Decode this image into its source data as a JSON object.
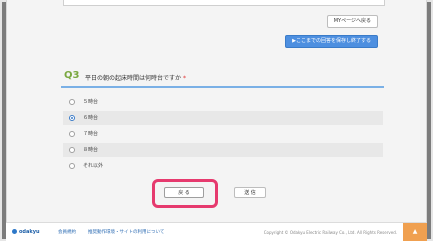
{
  "header": {
    "mypage_label": "MYページへ戻る",
    "save_label": "▶ここまでの回答を保存し終了する"
  },
  "question": {
    "number": "Q3",
    "text": "平日の朝の起床時間は何時台ですか",
    "required_mark": "*",
    "options": [
      {
        "label": "５時台",
        "selected": false
      },
      {
        "label": "６時台",
        "selected": true
      },
      {
        "label": "７時台",
        "selected": false
      },
      {
        "label": "８時台",
        "selected": false
      },
      {
        "label": "それ以外",
        "selected": false
      }
    ]
  },
  "actions": {
    "back_label": "戻 る",
    "send_label": "送 信"
  },
  "footer": {
    "logo_text": "odakyu",
    "link_members": "会員規約",
    "link_env": "推奨動作環境・サイトの利用について",
    "copyright": "Copyright © Odakyu Electric Railway Co., Ltd. All Rights Reserved.",
    "pagetop": "▲"
  },
  "colors": {
    "accent_blue": "#4d8fe0",
    "question_green": "#7aa840",
    "highlight_pink": "#e63a6e",
    "pagetop_orange": "#f0a050"
  }
}
